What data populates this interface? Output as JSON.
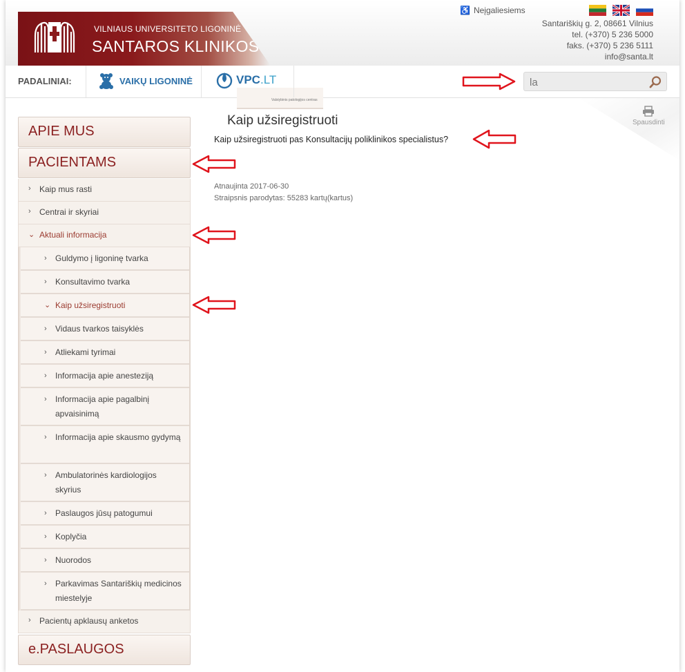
{
  "header": {
    "brand_small": "VILNIAUS UNIVERSITETO LIGONINĖ",
    "brand_big": "SANTAROS KLINIKOS",
    "accessibility_label": "Neįgaliesiems",
    "languages": [
      "lt",
      "en",
      "ru"
    ],
    "contact": {
      "address": "Santariškių g. 2, 08661 Vilnius",
      "phone": "tel. (+370) 5 236 5000",
      "fax": "faks. (+370) 5 236 5111",
      "email": "info@santa.lt"
    }
  },
  "subnav": {
    "label": "PADALINIAI:",
    "kids_label": "VAIKŲ LIGONINĖ",
    "vpc_label": "VPC",
    "vpc_suffix": ".LT",
    "vpc_sub": "Valstybinis patologijos centras"
  },
  "search": {
    "value": "la"
  },
  "print_label": "Spausdinti",
  "sidebar": {
    "sections": [
      "APIE MUS",
      "PACIENTAMS",
      "e.PASLAUGOS"
    ],
    "pacientams_items": [
      "Kaip mus rasti",
      "Centrai ir skyriai",
      "Aktuali informacija"
    ],
    "aktuali_items": [
      "Guldymo į ligoninę tvarka",
      "Konsultavimo tvarka",
      "Kaip užsiregistruoti",
      "Vidaus tvarkos taisyklės",
      "Atliekami tyrimai",
      "Informacija apie anesteziją",
      "Informacija apie pagalbinį apvaisinimą",
      "Informacija apie skausmo gydymą",
      "Ambulatorinės kardiologijos skyrius",
      "Paslaugos jūsų patogumui",
      "Koplyčia",
      "Nuorodos",
      "Parkavimas Santariškių medicinos miestelyje"
    ],
    "after_item": "Pacientų apklausų anketos"
  },
  "main": {
    "title": "Kaip užsiregistruoti",
    "text": "Kaip užsiregistruoti pas Konsultacijų poliklinikos specialistus?",
    "updated": "Atnaujinta 2017-06-30",
    "views": "Straipsnis parodytas: 55283 kartų(kartus)"
  },
  "colors": {
    "brand": "#8a1a1c",
    "annotation_arrow": "#e0141c",
    "link_blue": "#2a6fa8"
  }
}
